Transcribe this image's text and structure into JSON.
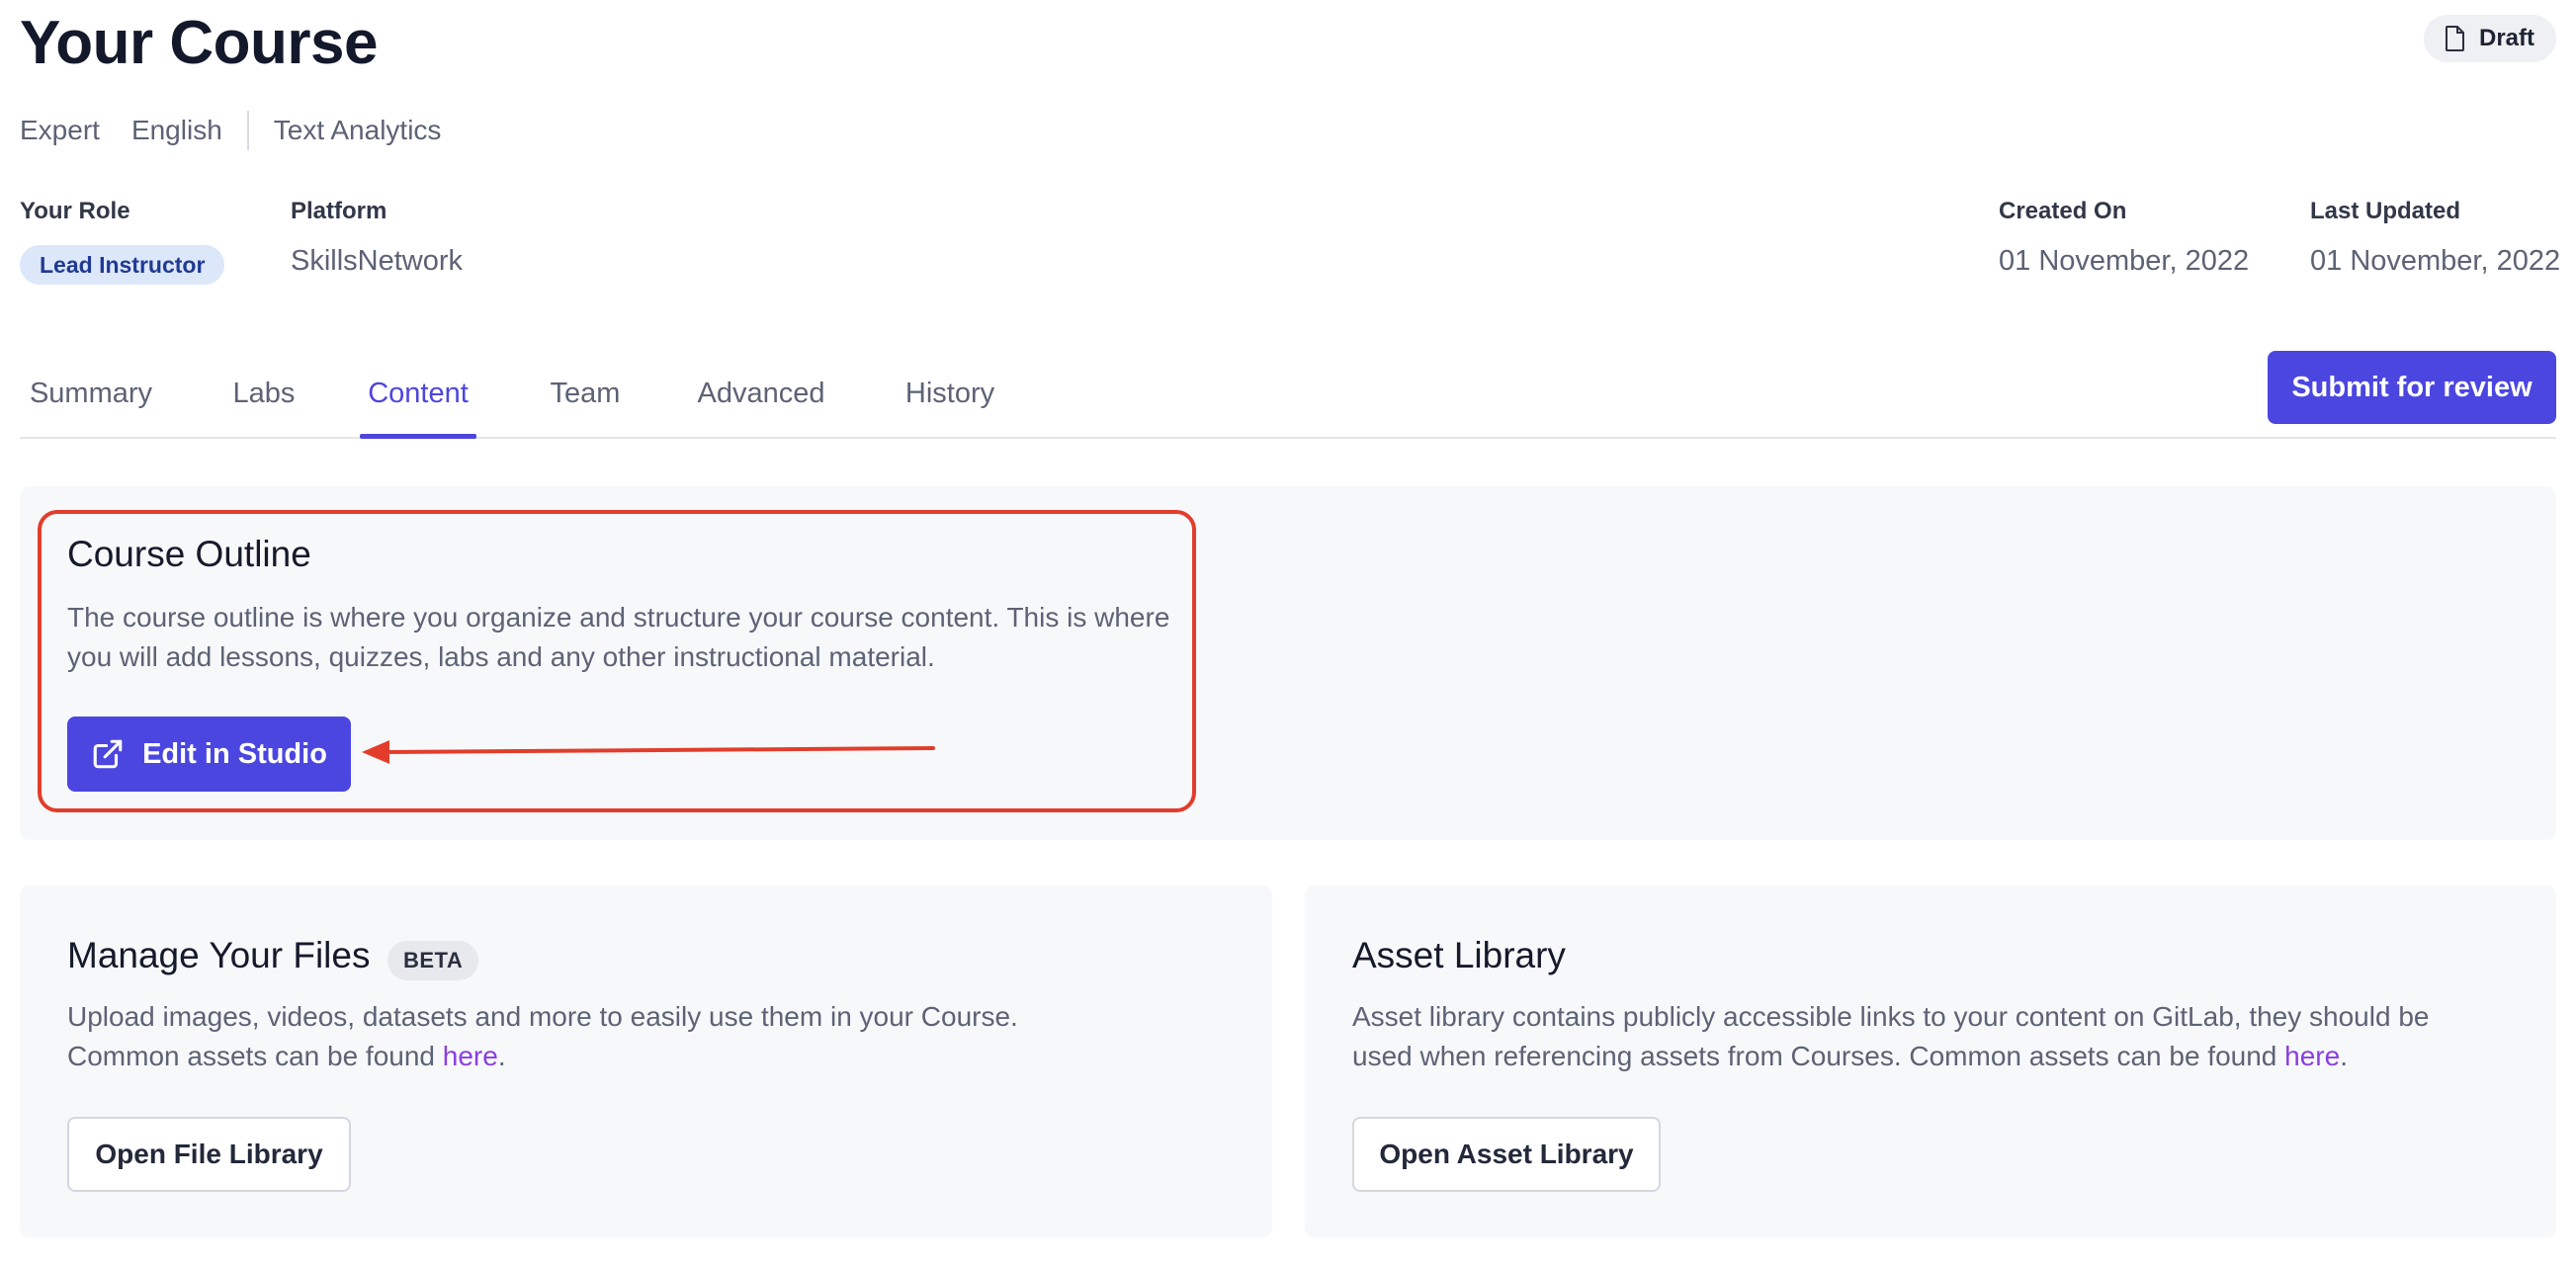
{
  "course": {
    "title": "Your Course",
    "status": "Draft",
    "level": "Expert",
    "language": "English",
    "topic": "Text Analytics"
  },
  "info": {
    "role_label": "Your Role",
    "role_value": "Lead Instructor",
    "platform_label": "Platform",
    "platform_value": "SkillsNetwork",
    "created_label": "Created On",
    "created_value": "01 November, 2022",
    "updated_label": "Last Updated",
    "updated_value": "01 November, 2022"
  },
  "tabs": [
    {
      "label": "Summary",
      "active": false
    },
    {
      "label": "Labs",
      "active": false
    },
    {
      "label": "Content",
      "active": true
    },
    {
      "label": "Team",
      "active": false
    },
    {
      "label": "Advanced",
      "active": false
    },
    {
      "label": "History",
      "active": false
    }
  ],
  "submit_label": "Submit for review",
  "outline": {
    "title": "Course Outline",
    "text_line1": "The course outline is where you organize and structure your course content. This is where",
    "text_line2": "you will add lessons, quizzes, labs and any other instructional material.",
    "button_label": "Edit in Studio",
    "button_icon": "external-link-icon"
  },
  "files": {
    "title": "Manage Your Files",
    "badge": "BETA",
    "text_line1": "Upload images, videos, datasets and more to easily use them in your Course.",
    "text_line2_prefix": "Common assets can be found ",
    "link_text": "here",
    "text_line2_suffix": ".",
    "button_label": "Open File Library"
  },
  "assets": {
    "title": "Asset Library",
    "text_line1": "Asset library contains publicly accessible links to your content on GitLab, they should be",
    "text_line2_prefix": "used when referencing assets from Courses. Common assets can be found ",
    "link_text": "here",
    "text_line2_suffix": ".",
    "button_label": "Open Asset Library"
  },
  "colors": {
    "primary": "#4b46e0",
    "active_tab": "#4e46dc",
    "annotation": "#e23d2c",
    "link": "#8a3fe0"
  }
}
